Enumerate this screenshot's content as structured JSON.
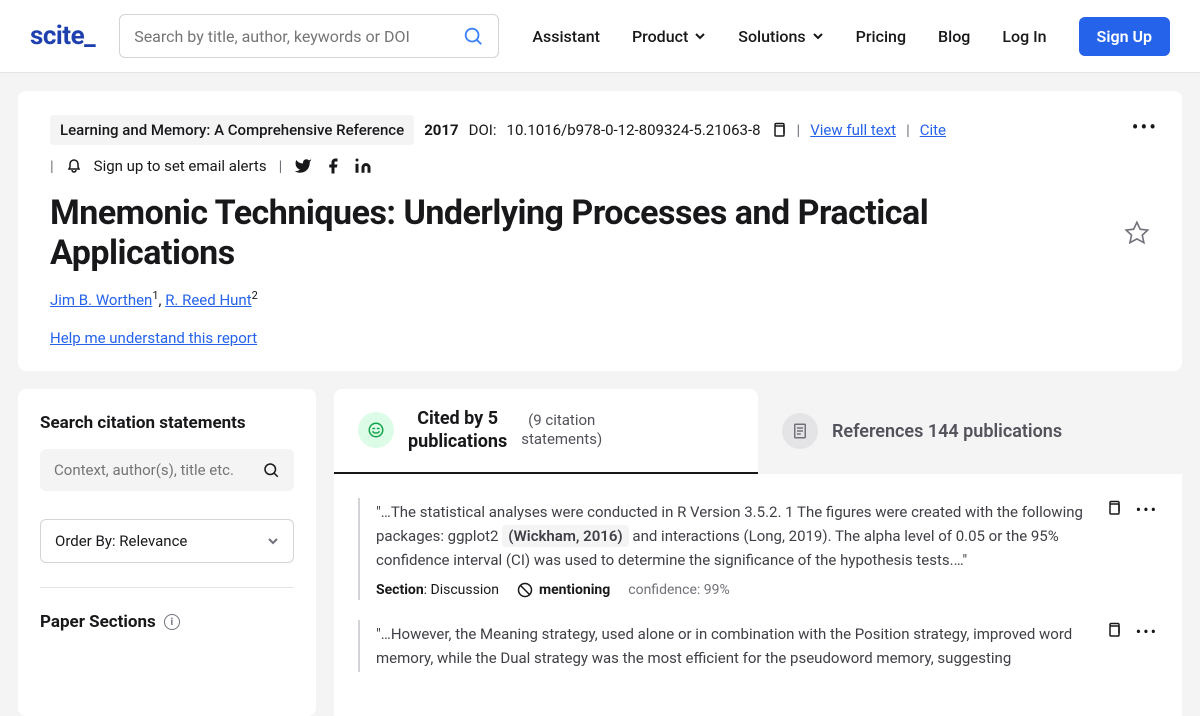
{
  "header": {
    "logo": "scite_",
    "search_placeholder": "Search by title, author, keywords or DOI",
    "nav": {
      "assistant": "Assistant",
      "product": "Product",
      "solutions": "Solutions",
      "pricing": "Pricing",
      "blog": "Blog",
      "login": "Log In",
      "signup": "Sign Up"
    }
  },
  "paper": {
    "journal": "Learning and Memory: A Comprehensive Reference",
    "year": "2017",
    "doi_label": "DOI:",
    "doi": "10.1016/b978-0-12-809324-5.21063-8",
    "view_full": "View full text",
    "cite": "Cite",
    "alerts": "Sign up to set email alerts",
    "title": "Mnemonic Techniques: Underlying Processes and Practical Applications",
    "authors": [
      {
        "name": "Jim B. Worthen",
        "aff": "1"
      },
      {
        "name": "R. Reed Hunt",
        "aff": "2"
      }
    ],
    "help": "Help me understand this report"
  },
  "sidebar": {
    "search_title": "Search citation statements",
    "filter_placeholder": "Context, author(s), title etc.",
    "order_label": "Order By: Relevance",
    "sections_title": "Paper Sections"
  },
  "tabs": {
    "cited_line1": "Cited by 5",
    "cited_line2": "publications",
    "cited_sub1": "(9 citation",
    "cited_sub2": "statements)",
    "refs": "References 144 publications"
  },
  "citations": [
    {
      "pre": "\"…The statistical analyses were conducted in R Version 3.5.2. 1 The figures were created with the following packages: ggplot2 ",
      "highlight": "(Wickham, 2016)",
      "post": " and interactions (Long, 2019). The alpha level of 0.05 or the 95% confidence interval (CI) was used to determine the significance of the hypothesis tests.…\"",
      "section_label": "Section",
      "section": ": Discussion",
      "type": "mentioning",
      "conf_label": "confidence: ",
      "conf": "99%"
    },
    {
      "pre": "\"…However, the Meaning strategy, used alone or in combination with the Position strategy, improved word memory, while the Dual strategy was the most efficient for the pseudoword memory, suggesting",
      "highlight": "",
      "post": ""
    }
  ]
}
